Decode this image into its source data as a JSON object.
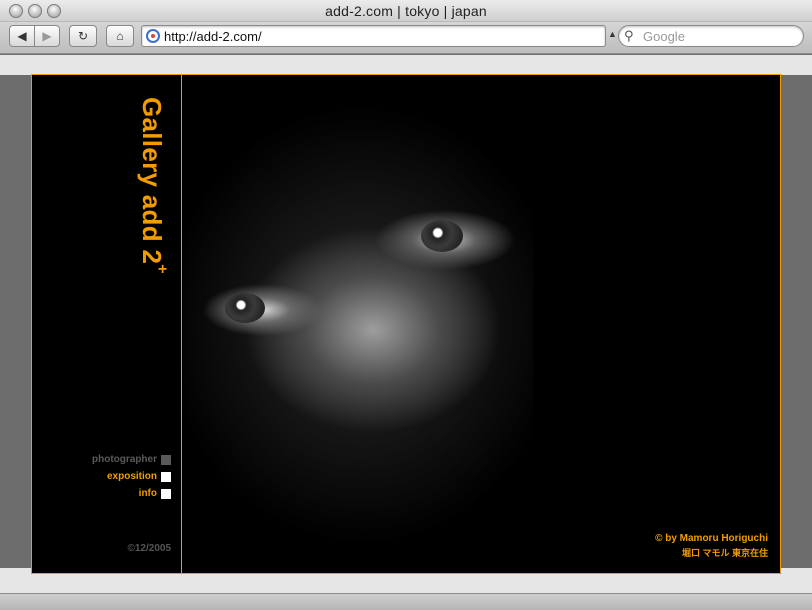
{
  "window": {
    "title": "add-2.com | tokyo | japan"
  },
  "toolbar": {
    "back_icon": "◀",
    "forward_icon": "▶",
    "reload_icon": "↻",
    "home_icon": "⌂",
    "url": "http://add-2.com/",
    "search_placeholder": "Google",
    "search_icon": "🔍"
  },
  "gallery": {
    "brand": "Gallery add 2",
    "brand_sup": "+",
    "nav": [
      {
        "label": "photographer"
      },
      {
        "label": "exposition"
      },
      {
        "label": "info"
      }
    ],
    "year": "©12/2005",
    "credit_line1": "© by Mamoru Horiguchi",
    "credit_line2": "堀口 マモル 東京在住"
  },
  "colors": {
    "accent": "#f29c00",
    "background": "#000000"
  }
}
